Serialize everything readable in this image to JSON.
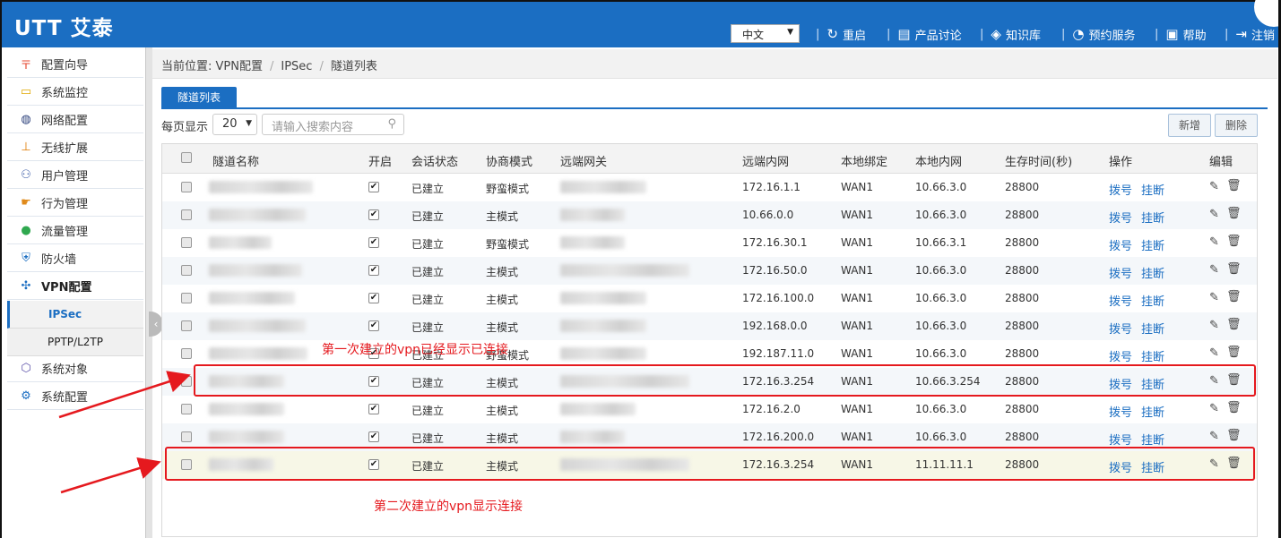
{
  "header": {
    "logo": "UTT 艾泰",
    "language": "中文",
    "nav": [
      {
        "label": "重启",
        "icon": "restart-icon",
        "glyph": "↻"
      },
      {
        "label": "产品讨论",
        "icon": "chat-icon",
        "glyph": "☐"
      },
      {
        "label": "知识库",
        "icon": "layers-icon",
        "glyph": "◈"
      },
      {
        "label": "预约服务",
        "icon": "service-icon",
        "glyph": "◔"
      },
      {
        "label": "帮助",
        "icon": "help-book-icon",
        "glyph": "▣"
      },
      {
        "label": "注销",
        "icon": "logout-icon",
        "glyph": "⇥"
      }
    ]
  },
  "sidebar": {
    "items": [
      {
        "label": "配置向导",
        "icon": "wizard-icon",
        "glyph": "〒",
        "color": "#e5452c"
      },
      {
        "label": "系统监控",
        "icon": "monitor-icon",
        "glyph": "▭",
        "color": "#e0a800"
      },
      {
        "label": "网络配置",
        "icon": "globe-icon",
        "glyph": "◍",
        "color": "#2a3f7a"
      },
      {
        "label": "无线扩展",
        "icon": "wireless-icon",
        "glyph": "⊥",
        "color": "#e07b00"
      },
      {
        "label": "用户管理",
        "icon": "users-icon",
        "glyph": "⚇",
        "color": "#3f5fa8"
      },
      {
        "label": "行为管理",
        "icon": "hand-icon",
        "glyph": "☛",
        "color": "#e08a1a"
      },
      {
        "label": "流量管理",
        "icon": "traffic-icon",
        "glyph": "●",
        "color": "#2fa84f"
      },
      {
        "label": "防火墙",
        "icon": "shield-icon",
        "glyph": "⛨",
        "color": "#1b6ec2"
      },
      {
        "label": "VPN配置",
        "icon": "vpn-icon",
        "glyph": "✣",
        "color": "#1b6ec2"
      }
    ],
    "sub_items": [
      {
        "label": "IPSec",
        "active": true
      },
      {
        "label": "PPTP/L2TP",
        "active": false
      }
    ],
    "items_after": [
      {
        "label": "系统对象",
        "icon": "cube-icon",
        "glyph": "⬡",
        "color": "#5a4fa8"
      },
      {
        "label": "系统配置",
        "icon": "gear-icon",
        "glyph": "⚙",
        "color": "#1b6ec2"
      }
    ]
  },
  "breadcrumb": {
    "prefix": "当前位置: VPN配置",
    "items": [
      "IPSec",
      "隧道列表"
    ]
  },
  "tab": {
    "label": "隧道列表"
  },
  "toolbar": {
    "per_page_label": "每页显示",
    "per_page_value": "20",
    "search_placeholder": "请输入搜索内容",
    "add_label": "新增",
    "delete_label": "删除"
  },
  "table": {
    "headers": [
      "隧道名称",
      "开启",
      "会话状态",
      "协商模式",
      "远端网关",
      "远端内网",
      "本地绑定",
      "本地内网",
      "生存时间(秒)",
      "操作",
      "编辑"
    ],
    "action_dial": "拨号",
    "action_hangup": "挂断",
    "rows": [
      {
        "enabled": true,
        "status": "已建立",
        "mode": "野蛮模式",
        "remote_net": "172.16.1.1",
        "bind": "WAN1",
        "local_net": "10.66.3.0",
        "ttl": "28800"
      },
      {
        "enabled": true,
        "status": "已建立",
        "mode": "主模式",
        "remote_net": "10.66.0.0",
        "bind": "WAN1",
        "local_net": "10.66.3.0",
        "ttl": "28800"
      },
      {
        "enabled": true,
        "status": "已建立",
        "mode": "野蛮模式",
        "remote_net": "172.16.30.1",
        "bind": "WAN1",
        "local_net": "10.66.3.1",
        "ttl": "28800"
      },
      {
        "enabled": true,
        "status": "已建立",
        "mode": "主模式",
        "remote_net": "172.16.50.0",
        "bind": "WAN1",
        "local_net": "10.66.3.0",
        "ttl": "28800"
      },
      {
        "enabled": true,
        "status": "已建立",
        "mode": "主模式",
        "remote_net": "172.16.100.0",
        "bind": "WAN1",
        "local_net": "10.66.3.0",
        "ttl": "28800"
      },
      {
        "enabled": true,
        "status": "已建立",
        "mode": "主模式",
        "remote_net": "192.168.0.0",
        "bind": "WAN1",
        "local_net": "10.66.3.0",
        "ttl": "28800"
      },
      {
        "enabled": true,
        "status": "已建立",
        "mode": "野蛮模式",
        "remote_net": "192.187.11.0",
        "bind": "WAN1",
        "local_net": "10.66.3.0",
        "ttl": "28800"
      },
      {
        "enabled": true,
        "status": "已建立",
        "mode": "主模式",
        "remote_net": "172.16.3.254",
        "bind": "WAN1",
        "local_net": "10.66.3.254",
        "ttl": "28800"
      },
      {
        "enabled": true,
        "status": "已建立",
        "mode": "主模式",
        "remote_net": "172.16.2.0",
        "bind": "WAN1",
        "local_net": "10.66.3.0",
        "ttl": "28800"
      },
      {
        "enabled": true,
        "status": "已建立",
        "mode": "主模式",
        "remote_net": "172.16.200.0",
        "bind": "WAN1",
        "local_net": "10.66.3.0",
        "ttl": "28800"
      },
      {
        "enabled": true,
        "status": "已建立",
        "mode": "主模式",
        "remote_net": "172.16.3.254",
        "bind": "WAN1",
        "local_net": "11.11.11.1",
        "ttl": "28800"
      }
    ]
  },
  "annotations": {
    "first": "第一次建立的vpn已经显示已连接",
    "second": "第二次建立的vpn显示连接",
    "color": "#e5191e"
  }
}
